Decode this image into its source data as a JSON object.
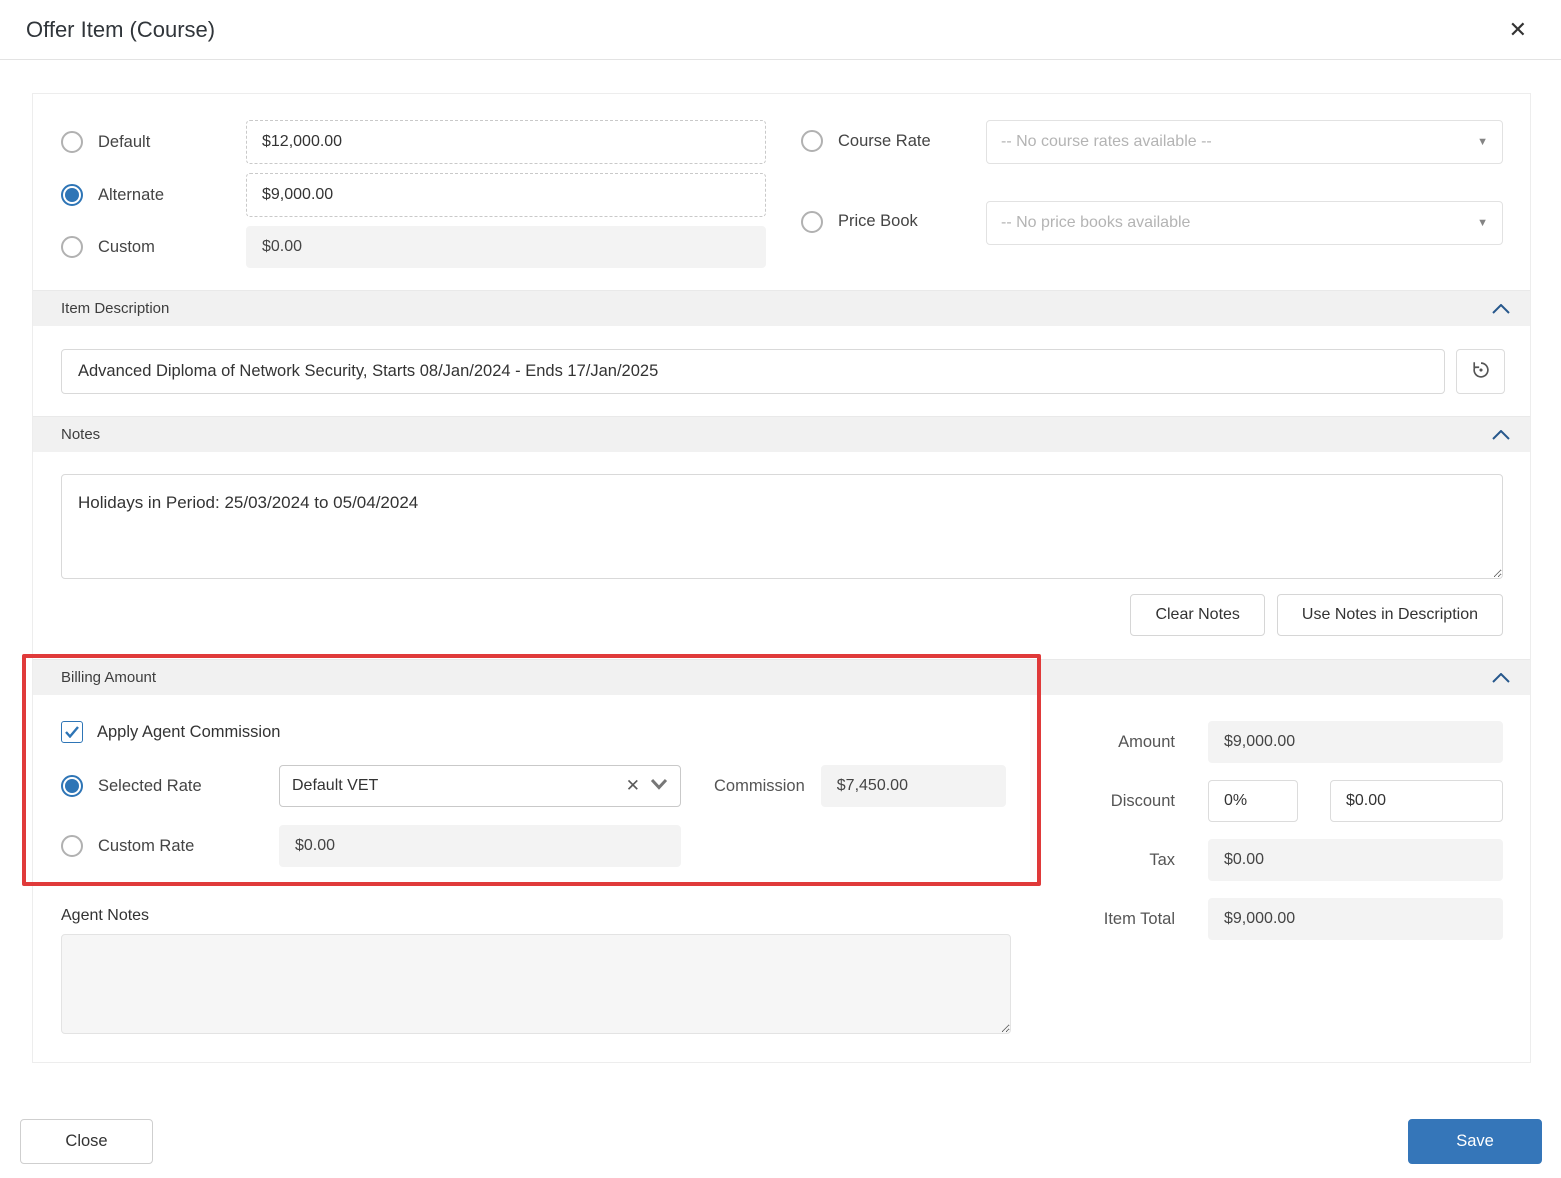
{
  "dialog": {
    "title": "Offer Item (Course)",
    "close_icon": "✕"
  },
  "pricing": {
    "options": [
      {
        "label": "Default",
        "value": "$12,000.00",
        "selected": false
      },
      {
        "label": "Alternate",
        "value": "$9,000.00",
        "selected": true
      },
      {
        "label": "Custom",
        "value": "$0.00",
        "selected": false
      }
    ],
    "course_rate": {
      "label": "Course Rate",
      "placeholder": "-- No course rates available --"
    },
    "price_book": {
      "label": "Price Book",
      "placeholder": "-- No price books available"
    }
  },
  "item_description": {
    "header": "Item Description",
    "value": "Advanced Diploma of Network Security, Starts 08/Jan/2024 - Ends 17/Jan/2025"
  },
  "notes": {
    "header": "Notes",
    "value": "Holidays in Period: 25/03/2024 to 05/04/2024",
    "clear_button": "Clear Notes",
    "use_button": "Use Notes in Description"
  },
  "billing": {
    "header": "Billing Amount",
    "apply_agent_commission": "Apply Agent Commission",
    "selected_rate_label": "Selected Rate",
    "selected_rate_value": "Default VET",
    "commission_label": "Commission",
    "commission_value": "$7,450.00",
    "custom_rate_label": "Custom Rate",
    "custom_rate_value": "$0.00"
  },
  "totals": {
    "amount_label": "Amount",
    "amount_value": "$9,000.00",
    "discount_label": "Discount",
    "discount_percent": "0%",
    "discount_value": "$0.00",
    "tax_label": "Tax",
    "tax_value": "$0.00",
    "item_total_label": "Item Total",
    "item_total_value": "$9,000.00"
  },
  "agent_notes": {
    "label": "Agent Notes",
    "value": ""
  },
  "footer": {
    "close_label": "Close",
    "save_label": "Save"
  },
  "colors": {
    "accent": "#2e75b6",
    "save": "#3576b9",
    "chevron": "#27588c",
    "annotation": "#e03a3a"
  }
}
